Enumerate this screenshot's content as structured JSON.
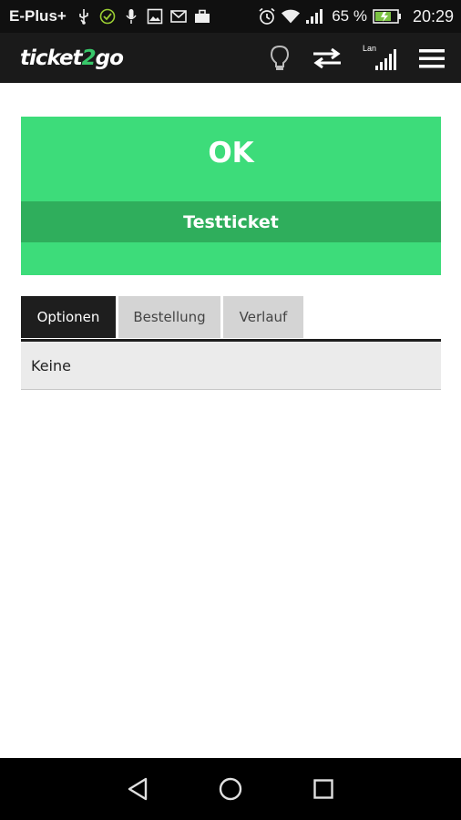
{
  "status_bar": {
    "carrier": "E-Plus+",
    "battery_percent": "65 %",
    "time": "20:29",
    "icons": [
      "usb-icon",
      "check-circle-icon",
      "microphone-icon",
      "image-icon",
      "mail-icon",
      "briefcase-icon",
      "alarm-icon",
      "wifi-icon",
      "signal-icon",
      "battery-charging-icon"
    ]
  },
  "app_bar": {
    "logo_pre": "ticket",
    "logo_two": "2",
    "logo_post": "go",
    "signal_label": "Lan",
    "icons": [
      "lightbulb-icon",
      "swap-arrows-icon",
      "signal-bars-icon",
      "menu-icon"
    ]
  },
  "result": {
    "status": "OK",
    "ticket_label": "Testticket",
    "color": "#3ddc7a",
    "band_color": "#2fae5c"
  },
  "tabs": [
    {
      "label": "Optionen",
      "active": true
    },
    {
      "label": "Bestellung",
      "active": false
    },
    {
      "label": "Verlauf",
      "active": false
    }
  ],
  "panel": {
    "text": "Keine"
  },
  "nav_bar": {
    "icons": [
      "back-icon",
      "home-icon",
      "recents-icon"
    ]
  }
}
